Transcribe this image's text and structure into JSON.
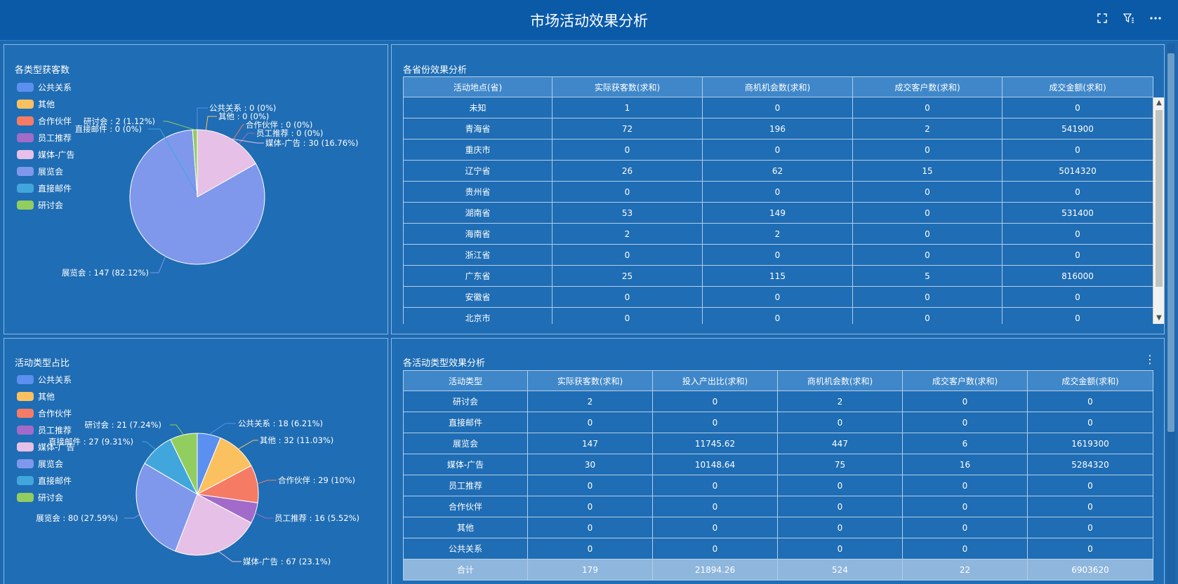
{
  "header": {
    "title": "市场活动效果分析"
  },
  "tools": [
    {
      "name": "fullscreen-icon",
      "glyph": "⛶"
    },
    {
      "name": "filter-icon",
      "glyph": "⩥"
    },
    {
      "name": "more-icon",
      "glyph": "⋯"
    }
  ],
  "legend_labels": [
    "公共关系",
    "其他",
    "合作伙伴",
    "员工推荐",
    "媒体-广告",
    "展览会",
    "直接邮件",
    "研讨会"
  ],
  "colors": {
    "公共关系": "#5b8ff0",
    "其他": "#fbc160",
    "合作伙伴": "#f57b65",
    "员工推荐": "#a26bc9",
    "媒体-广告": "#e6c0e6",
    "展览会": "#7f98ec",
    "直接邮件": "#41a6dc",
    "研讨会": "#92cd5f"
  },
  "panel1": {
    "title": "各类型获客数",
    "chart_data": {
      "type": "pie",
      "categories": [
        "公共关系",
        "其他",
        "合作伙伴",
        "员工推荐",
        "媒体-广告",
        "展览会",
        "直接邮件",
        "研讨会"
      ],
      "values": [
        0,
        0,
        0,
        0,
        30,
        147,
        0,
        2
      ],
      "labels": [
        "公共关系 : 0 (0%)",
        "其他 : 0 (0%)",
        "合作伙伴 : 0 (0%)",
        "员工推荐 : 0 (0%)",
        "媒体-广告 : 30 (16.76%)",
        "展览会 : 147 (82.12%)",
        "直接邮件 : 0 (0%)",
        "研讨会 : 2 (1.12%)"
      ]
    }
  },
  "panel3": {
    "title": "活动类型占比",
    "chart_data": {
      "type": "pie",
      "categories": [
        "公共关系",
        "其他",
        "合作伙伴",
        "员工推荐",
        "媒体-广告",
        "展览会",
        "直接邮件",
        "研讨会"
      ],
      "values": [
        18,
        32,
        29,
        16,
        67,
        80,
        27,
        21
      ],
      "labels": [
        "公共关系 : 18 (6.21%)",
        "其他 : 32 (11.03%)",
        "合作伙伴 : 29 (10%)",
        "员工推荐 : 16 (5.52%)",
        "媒体-广告 : 67 (23.1%)",
        "展览会 : 80 (27.59%)",
        "直接邮件 : 27 (9.31%)",
        "研讨会 : 21 (7.24%)"
      ]
    }
  },
  "panel2": {
    "title": "各省份效果分析",
    "columns": [
      "活动地点(省)",
      "实际获客数(求和)",
      "商机机会数(求和)",
      "成交客户数(求和)",
      "成交金额(求和)"
    ],
    "rows": [
      [
        "未知",
        "1",
        "0",
        "0",
        "0"
      ],
      [
        "青海省",
        "72",
        "196",
        "2",
        "541900"
      ],
      [
        "重庆市",
        "0",
        "0",
        "0",
        "0"
      ],
      [
        "辽宁省",
        "26",
        "62",
        "15",
        "5014320"
      ],
      [
        "贵州省",
        "0",
        "0",
        "0",
        "0"
      ],
      [
        "湖南省",
        "53",
        "149",
        "0",
        "531400"
      ],
      [
        "海南省",
        "2",
        "2",
        "0",
        "0"
      ],
      [
        "浙江省",
        "0",
        "0",
        "0",
        "0"
      ],
      [
        "广东省",
        "25",
        "115",
        "5",
        "816000"
      ],
      [
        "安徽省",
        "0",
        "0",
        "0",
        "0"
      ],
      [
        "北京市",
        "0",
        "0",
        "0",
        "0"
      ]
    ]
  },
  "panel4": {
    "title": "各活动类型效果分析",
    "menu_glyph": "⋮",
    "columns": [
      "活动类型",
      "实际获客数(求和)",
      "投入产出比(求和)",
      "商机机会数(求和)",
      "成交客户数(求和)",
      "成交金额(求和)"
    ],
    "rows": [
      [
        "研讨会",
        "2",
        "0",
        "2",
        "0",
        "0"
      ],
      [
        "直接邮件",
        "0",
        "0",
        "0",
        "0",
        "0"
      ],
      [
        "展览会",
        "147",
        "11745.62",
        "447",
        "6",
        "1619300"
      ],
      [
        "媒体-广告",
        "30",
        "10148.64",
        "75",
        "16",
        "5284320"
      ],
      [
        "员工推荐",
        "0",
        "0",
        "0",
        "0",
        "0"
      ],
      [
        "合作伙伴",
        "0",
        "0",
        "0",
        "0",
        "0"
      ],
      [
        "其他",
        "0",
        "0",
        "0",
        "0",
        "0"
      ],
      [
        "公共关系",
        "0",
        "0",
        "0",
        "0",
        "0"
      ]
    ],
    "total": [
      "合计",
      "179",
      "21894.26",
      "524",
      "22",
      "6903620"
    ]
  }
}
